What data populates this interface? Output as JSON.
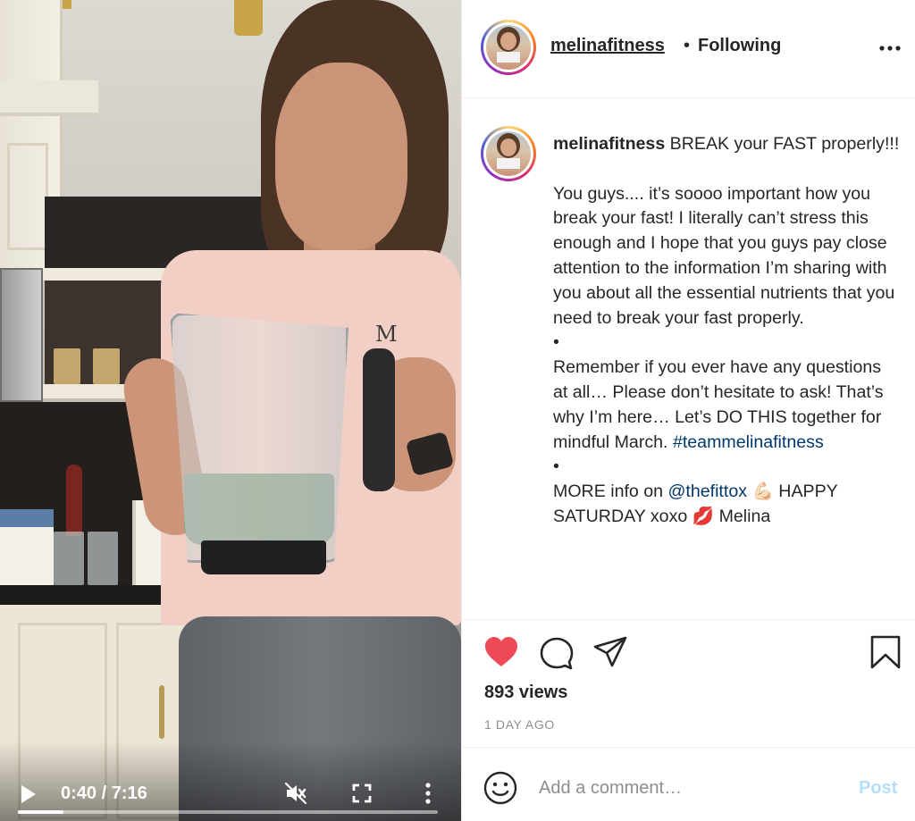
{
  "video": {
    "time_display": "0:40 / 7:16",
    "progress_fraction": 0.109,
    "shirt_letters": "M"
  },
  "header": {
    "username": "melinafitness",
    "separator": "•",
    "follow_status": "Following"
  },
  "caption": {
    "username": "melinafitness",
    "headline": " BREAK your FAST properly!!!",
    "paragraph1": "You guys.... it’s soooo important how you break your fast! I literally can’t stress this enough and I hope that you guys pay close attention to the information I’m sharing with you about all the essential nutrients that you need to break your fast properly.",
    "bullet1": "•",
    "paragraph2_text": "Remember if you ever have any questions at all… Please don’t hesitate to ask! That’s why I’m here… Let’s DO THIS together for mindful March. ",
    "hashtag": "#teammelinafitness",
    "bullet2": "•",
    "paragraph3_prefix": "MORE info on ",
    "mention": "@thefittox",
    "paragraph3_mid": " 💪🏻 HAPPY SATURDAY xoxo ",
    "paragraph3_kiss": "💋",
    "paragraph3_suffix": " Melina"
  },
  "actions": {
    "views": "893 views",
    "time_ago": "1 DAY AGO",
    "liked": true
  },
  "comment": {
    "placeholder": "Add a comment…",
    "post_label": "Post"
  },
  "colors": {
    "like_red": "#ed4956",
    "link_blue": "#00376b",
    "post_disabled": "#b2dffc",
    "muted_gray": "#8e8e8e"
  },
  "icons": [
    "play-icon",
    "mute-icon",
    "fullscreen-icon",
    "more-vertical-icon",
    "more-horizontal-icon",
    "heart-icon",
    "comment-icon",
    "share-icon",
    "bookmark-icon",
    "emoji-icon"
  ]
}
